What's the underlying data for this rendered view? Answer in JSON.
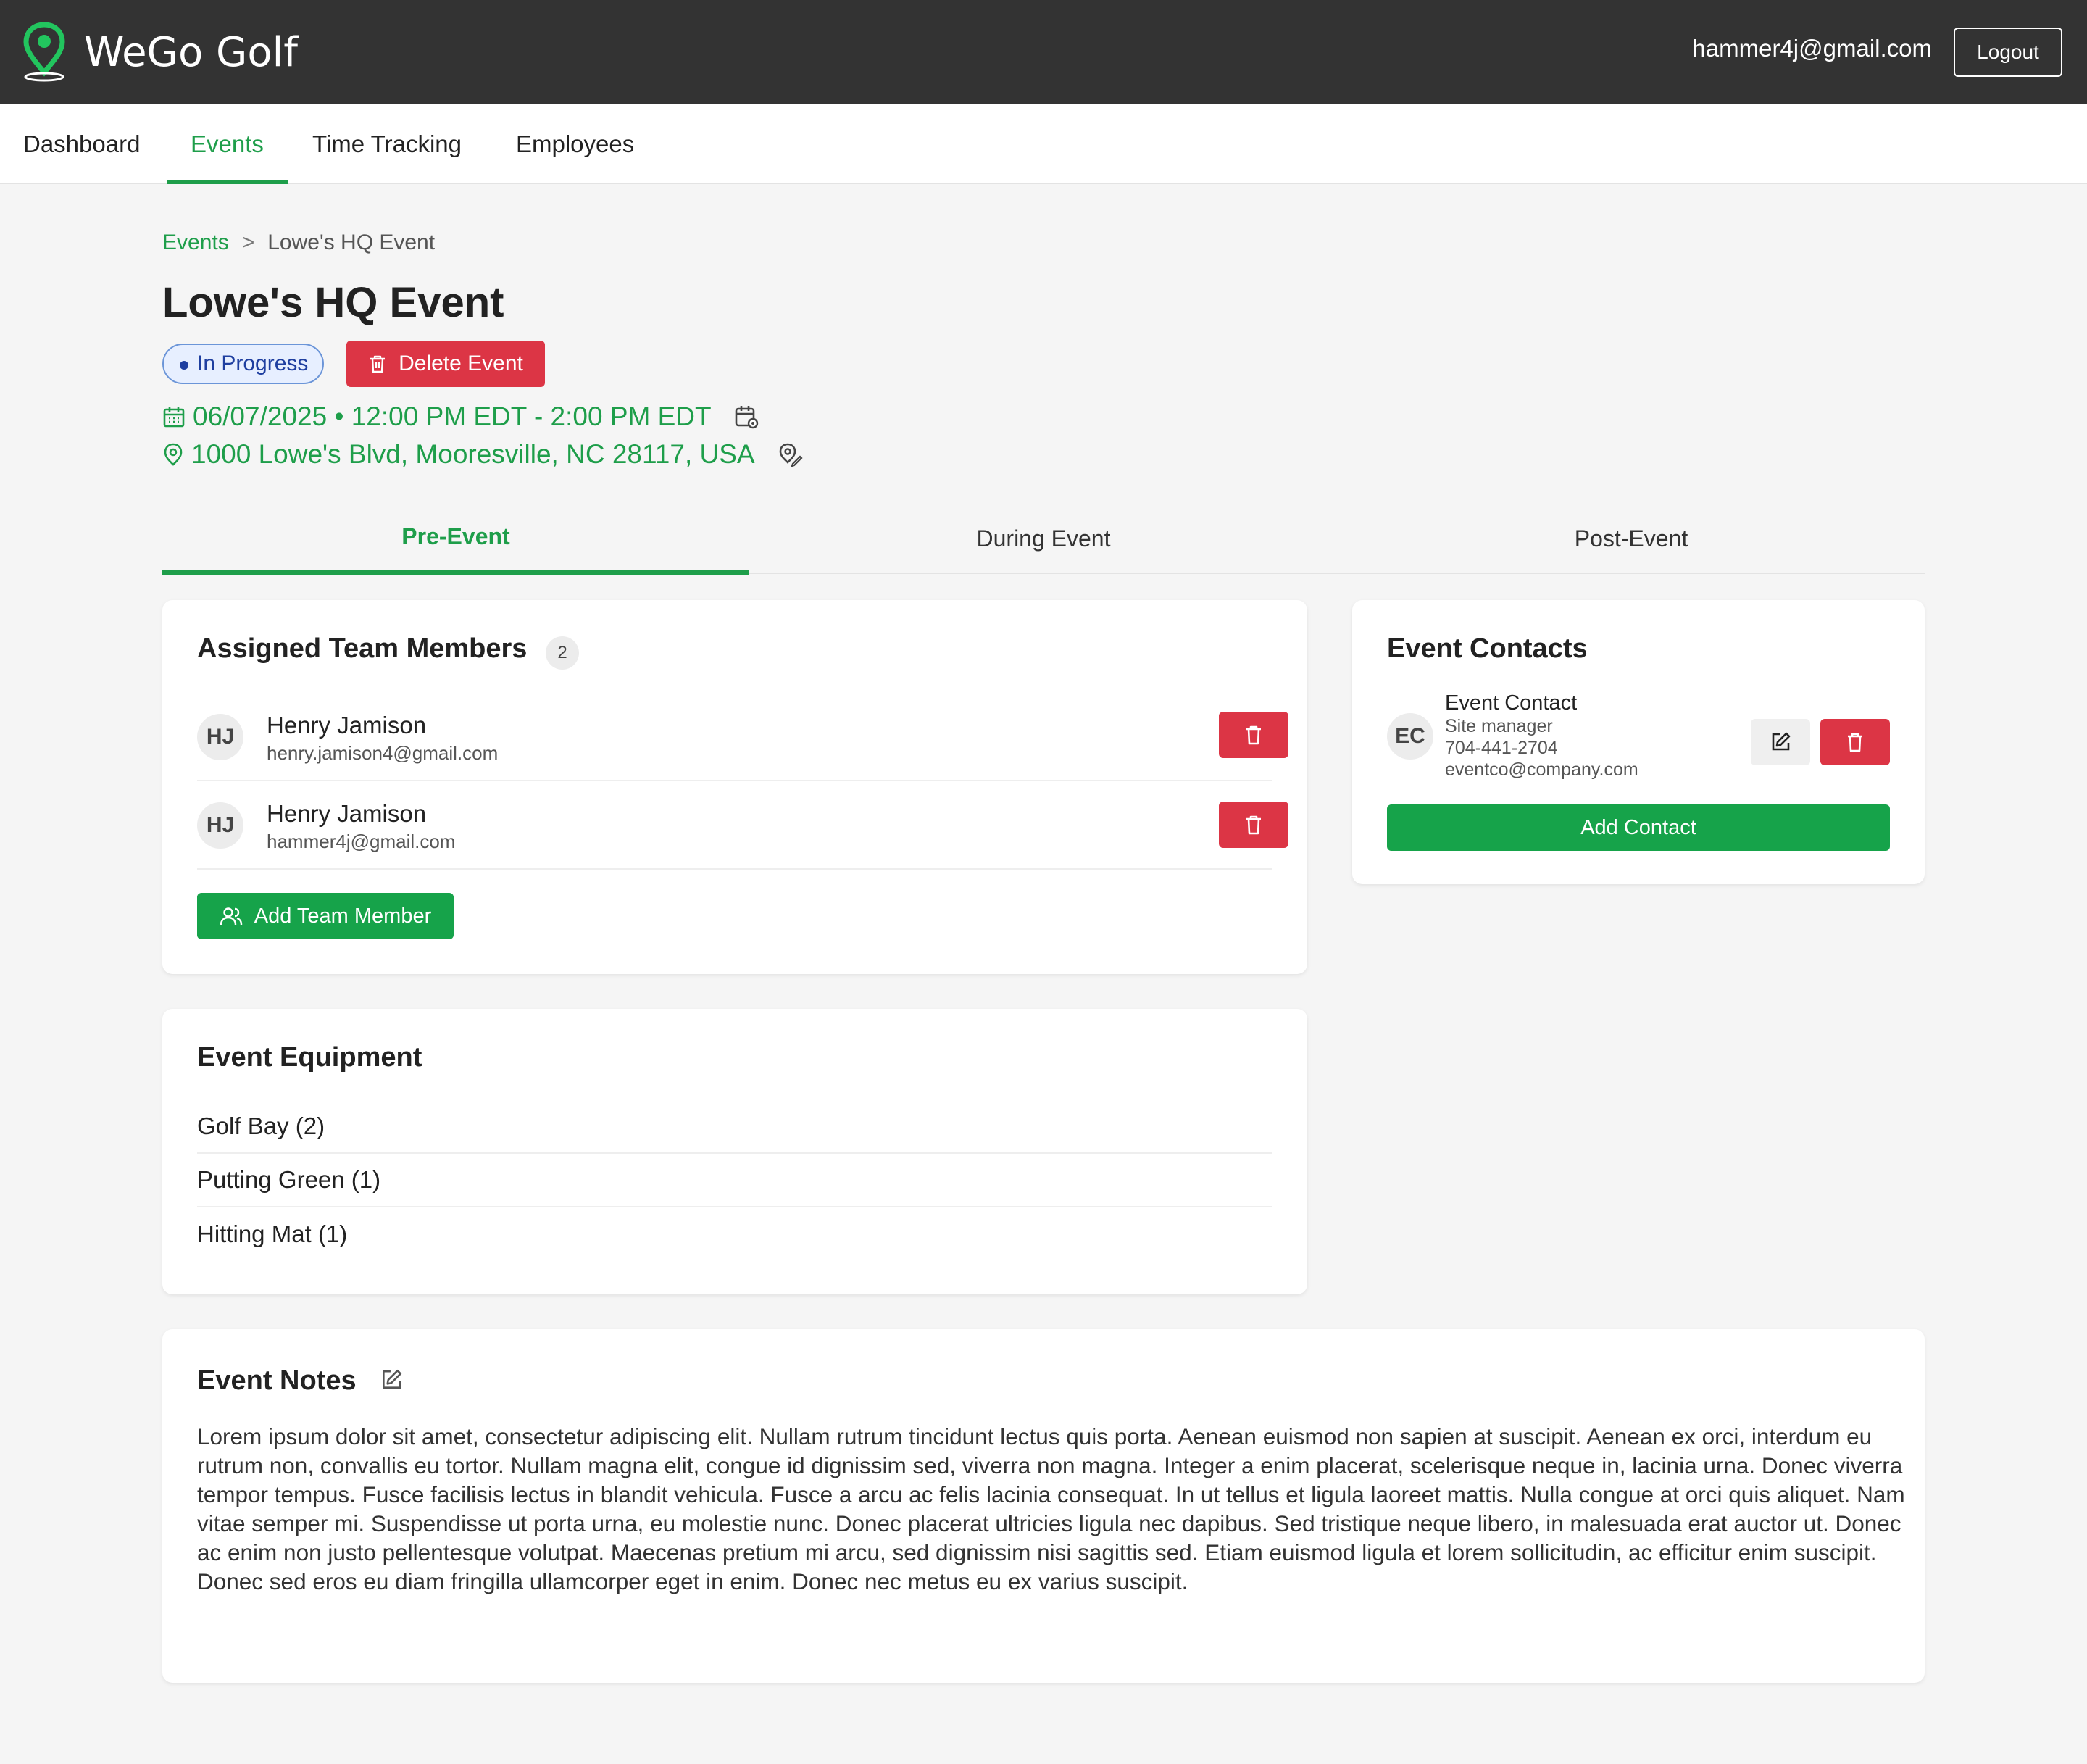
{
  "header": {
    "brand_name": "WeGo Golf",
    "user_email": "hammer4j@gmail.com",
    "logout_label": "Logout",
    "colors": {
      "background": "#333333",
      "brand_icon": "#22c55e"
    }
  },
  "nav": {
    "items": [
      {
        "label": "Dashboard",
        "active": false
      },
      {
        "label": "Events",
        "active": true
      },
      {
        "label": "Time Tracking",
        "active": false
      },
      {
        "label": "Employees",
        "active": false
      }
    ]
  },
  "breadcrumb": {
    "parent": "Events",
    "separator": ">",
    "current": "Lowe's HQ Event"
  },
  "event": {
    "title": "Lowe's HQ Event",
    "status": "In Progress",
    "delete_label": "Delete Event",
    "datetime": "06/07/2025 • 12:00 PM EDT - 2:00 PM EDT",
    "address": "1000 Lowe's Blvd, Mooresville, NC 28117, USA"
  },
  "tabs": [
    {
      "label": "Pre-Event",
      "active": true
    },
    {
      "label": "During Event",
      "active": false
    },
    {
      "label": "Post-Event",
      "active": false
    }
  ],
  "team": {
    "title": "Assigned Team Members",
    "count": "2",
    "members": [
      {
        "initials": "HJ",
        "name": "Henry Jamison",
        "email": "henry.jamison4@gmail.com"
      },
      {
        "initials": "HJ",
        "name": "Henry Jamison",
        "email": "hammer4j@gmail.com"
      }
    ],
    "add_label": "Add Team Member"
  },
  "contacts": {
    "title": "Event Contacts",
    "items": [
      {
        "initials": "EC",
        "name": "Event Contact",
        "role": "Site manager",
        "phone": "704-441-2704",
        "email": "eventco@company.com"
      }
    ],
    "add_label": "Add Contact"
  },
  "equipment": {
    "title": "Event Equipment",
    "items": [
      "Golf Bay (2)",
      "Putting Green (1)",
      "Hitting Mat (1)"
    ]
  },
  "notes": {
    "title": "Event Notes",
    "text": "Lorem ipsum dolor sit amet, consectetur adipiscing elit. Nullam rutrum tincidunt lectus quis porta. Aenean euismod non sapien at suscipit. Aenean ex orci, interdum eu rutrum non, convallis eu tortor. Nullam magna elit, congue id dignissim sed, viverra non magna. Integer a enim placerat, scelerisque neque in, lacinia urna. Donec viverra tempor tempus. Fusce facilisis lectus in blandit vehicula. Fusce a arcu ac felis lacinia consequat. In ut tellus et ligula laoreet mattis. Nulla congue at orci quis aliquet. Nam vitae semper mi. Suspendisse ut porta urna, eu molestie nunc. Donec placerat ultricies ligula nec dapibus. Sed tristique neque libero, in malesuada erat auctor ut. Donec ac enim non justo pellentesque volutpat. Maecenas pretium mi arcu, sed dignissim nisi sagittis sed. Etiam euismod ligula et lorem sollicitudin, ac efficitur enim suscipit. Donec sed eros eu diam fringilla ullamcorper eget in enim. Donec nec metus eu ex varius suscipit."
  }
}
